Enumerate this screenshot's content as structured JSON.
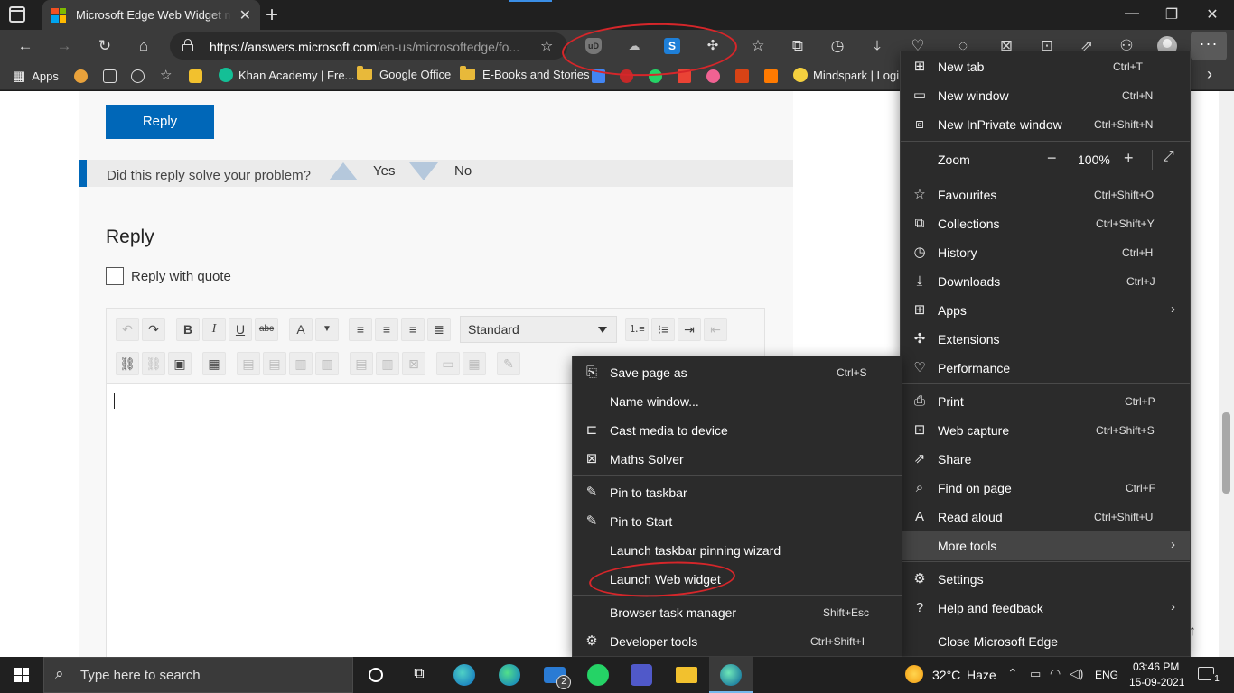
{
  "window": {
    "tab_title": "Microsoft Edge Web Widget not",
    "minimize": "—",
    "maximize": "❐",
    "close": "✕"
  },
  "toolbar": {
    "url_host": "https://answers.microsoft.com",
    "url_path": "/en-us/microsoftedge/fo...",
    "extensions": [
      "uBlock",
      "Cloud",
      "S",
      "Puzzle"
    ],
    "more_label": "···"
  },
  "favorites": {
    "apps": "Apps",
    "khan": "Khan Academy | Fre...",
    "google_office": "Google Office",
    "ebooks": "E-Books and Stories",
    "mindspark": "Mindspark | Login",
    "more_chevron": "›"
  },
  "page": {
    "reply_button": "Reply",
    "solve_question": "Did this reply solve your problem?",
    "yes": "Yes",
    "no": "No",
    "reply_heading": "Reply",
    "quote_label": "Reply with quote",
    "style_select": "Standard"
  },
  "main_menu": {
    "new_tab": {
      "label": "New tab",
      "shortcut": "Ctrl+T"
    },
    "new_window": {
      "label": "New window",
      "shortcut": "Ctrl+N"
    },
    "new_inprivate": {
      "label": "New InPrivate window",
      "shortcut": "Ctrl+Shift+N"
    },
    "zoom": {
      "label": "Zoom",
      "value": "100%"
    },
    "favourites": {
      "label": "Favourites",
      "shortcut": "Ctrl+Shift+O"
    },
    "collections": {
      "label": "Collections",
      "shortcut": "Ctrl+Shift+Y"
    },
    "history": {
      "label": "History",
      "shortcut": "Ctrl+H"
    },
    "downloads": {
      "label": "Downloads",
      "shortcut": "Ctrl+J"
    },
    "apps": {
      "label": "Apps"
    },
    "extensions": {
      "label": "Extensions"
    },
    "performance": {
      "label": "Performance"
    },
    "print": {
      "label": "Print",
      "shortcut": "Ctrl+P"
    },
    "web_capture": {
      "label": "Web capture",
      "shortcut": "Ctrl+Shift+S"
    },
    "share": {
      "label": "Share"
    },
    "find_on_page": {
      "label": "Find on page",
      "shortcut": "Ctrl+F"
    },
    "read_aloud": {
      "label": "Read aloud",
      "shortcut": "Ctrl+Shift+U"
    },
    "more_tools": {
      "label": "More tools"
    },
    "settings": {
      "label": "Settings"
    },
    "help": {
      "label": "Help and feedback"
    },
    "close_edge": {
      "label": "Close Microsoft Edge"
    }
  },
  "sub_menu": {
    "save_page": {
      "label": "Save page as",
      "shortcut": "Ctrl+S"
    },
    "name_window": {
      "label": "Name window..."
    },
    "cast": {
      "label": "Cast media to device"
    },
    "maths": {
      "label": "Maths Solver"
    },
    "pin_taskbar": {
      "label": "Pin to taskbar"
    },
    "pin_start": {
      "label": "Pin to Start"
    },
    "pin_wizard": {
      "label": "Launch taskbar pinning wizard"
    },
    "web_widget": {
      "label": "Launch Web widget"
    },
    "task_manager": {
      "label": "Browser task manager",
      "shortcut": "Shift+Esc"
    },
    "dev_tools": {
      "label": "Developer tools",
      "shortcut": "Ctrl+Shift+I"
    }
  },
  "taskbar": {
    "search_placeholder": "Type here to search",
    "mail_badge": "2",
    "weather_temp": "32°C",
    "weather_desc": "Haze",
    "language": "ENG",
    "time": "03:46 PM",
    "date": "15-09-2021",
    "notifications": "1"
  },
  "colors": {
    "annotation": "#d6262a",
    "accent_blue": "#0067b8",
    "menu_bg": "#2b2b2b"
  }
}
